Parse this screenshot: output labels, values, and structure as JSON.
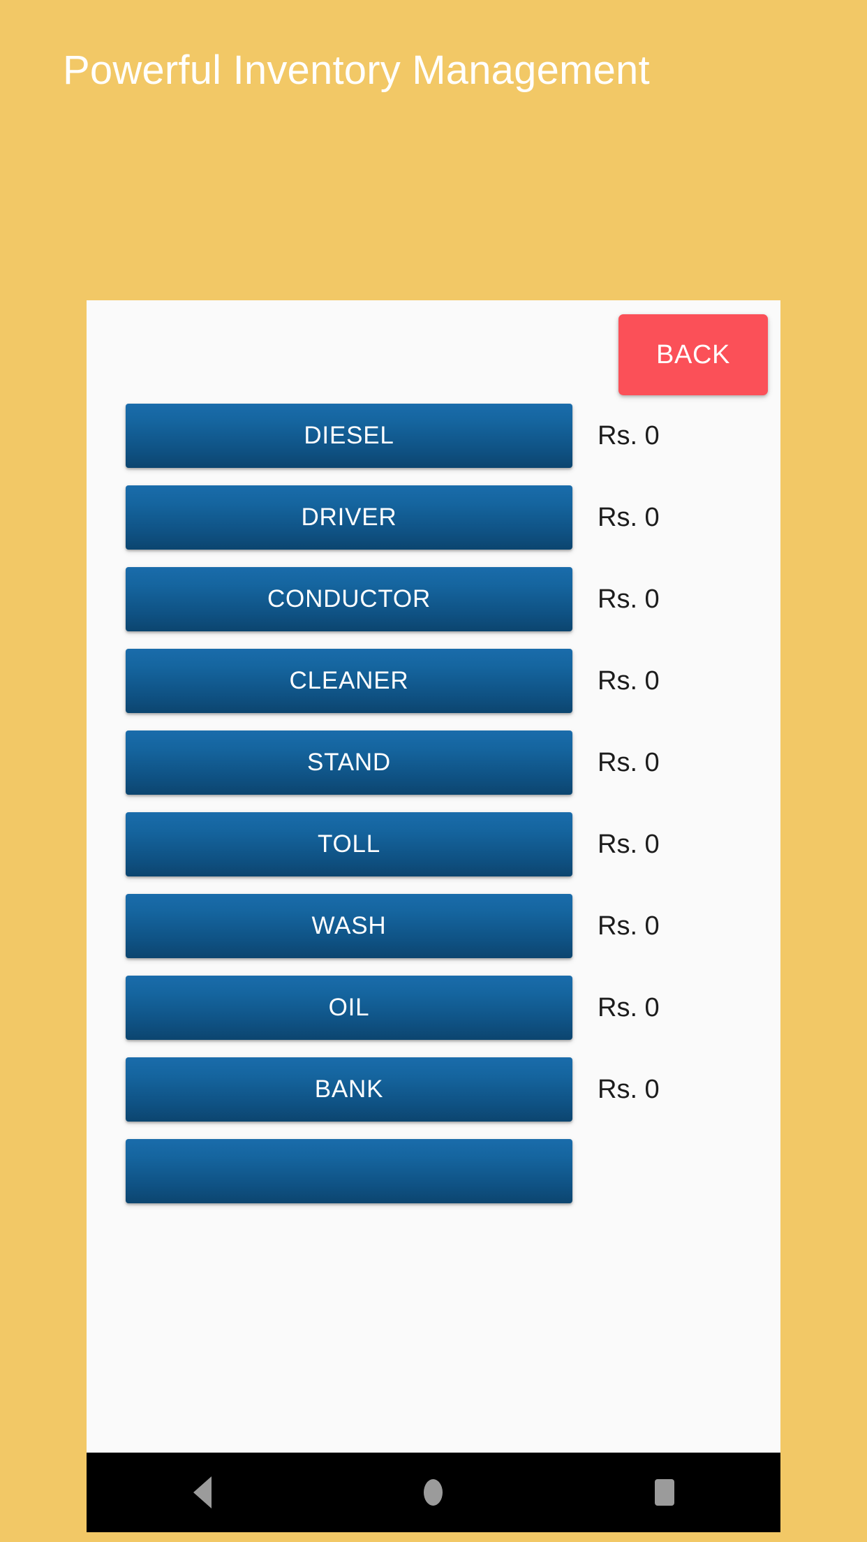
{
  "header": {
    "title": "Powerful Inventory Management"
  },
  "colors": {
    "background": "#F2C866",
    "card": "#FAFAFA",
    "back_button": "#FB5058",
    "expense_button_top": "#1A6CAB",
    "expense_button_bottom": "#0C456F",
    "amount_text": "#1C1C1C",
    "nav_bar": "#000000",
    "nav_icon": "#9B9B9B"
  },
  "card": {
    "back_button": {
      "label": "BACK",
      "icon": "back-arrow"
    },
    "expenses": [
      {
        "label": "DIESEL",
        "amount": "Rs. 0"
      },
      {
        "label": "DRIVER",
        "amount": "Rs. 0"
      },
      {
        "label": "CONDUCTOR",
        "amount": "Rs. 0"
      },
      {
        "label": "CLEANER",
        "amount": "Rs. 0"
      },
      {
        "label": "STAND",
        "amount": "Rs. 0"
      },
      {
        "label": "TOLL",
        "amount": "Rs. 0"
      },
      {
        "label": "WASH",
        "amount": "Rs. 0"
      },
      {
        "label": "OIL",
        "amount": "Rs. 0"
      },
      {
        "label": "BANK",
        "amount": "Rs. 0"
      },
      {
        "label": "",
        "amount": ""
      }
    ]
  },
  "nav_bar": {
    "buttons": [
      {
        "icon": "triangle-back-icon"
      },
      {
        "icon": "circle-home-icon"
      },
      {
        "icon": "square-recents-icon"
      }
    ]
  }
}
